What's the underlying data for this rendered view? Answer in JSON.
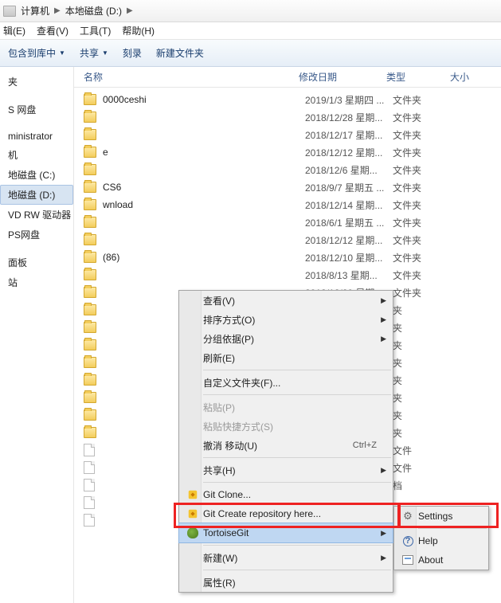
{
  "breadcrumb": {
    "seg1": "计算机",
    "seg2": "本地磁盘 (D:)"
  },
  "menubar": {
    "edit": "辑(E)",
    "view": "查看(V)",
    "tools": "工具(T)",
    "help": "帮助(H)"
  },
  "toolbar": {
    "include": "包含到库中",
    "share": "共享",
    "burn": "刻录",
    "newfolder": "新建文件夹"
  },
  "sidebar": {
    "items": [
      "夹",
      "",
      "S 网盘",
      "",
      "ministrator",
      "机",
      "地磁盘 (C:)",
      "地磁盘 (D:)",
      "VD RW 驱动器 (",
      "PS网盘",
      "",
      "面板",
      "站"
    ],
    "selected_index": 7
  },
  "columns": {
    "name": "名称",
    "date": "修改日期",
    "type": "类型",
    "size": "大小"
  },
  "files": [
    {
      "name": "0000ceshi",
      "date": "2019/1/3 星期四 ...",
      "type": "文件夹",
      "kind": "folder"
    },
    {
      "name": "",
      "date": "2018/12/28 星期...",
      "type": "文件夹",
      "kind": "folder"
    },
    {
      "name": "",
      "date": "2018/12/17 星期...",
      "type": "文件夹",
      "kind": "folder"
    },
    {
      "name": "e",
      "date": "2018/12/12 星期...",
      "type": "文件夹",
      "kind": "folder"
    },
    {
      "name": "",
      "date": "2018/12/6 星期...",
      "type": "文件夹",
      "kind": "folder"
    },
    {
      "name": "CS6",
      "date": "2018/9/7 星期五 ...",
      "type": "文件夹",
      "kind": "folder"
    },
    {
      "name": "wnload",
      "date": "2018/12/14 星期...",
      "type": "文件夹",
      "kind": "folder"
    },
    {
      "name": "",
      "date": "2018/6/1 星期五 ...",
      "type": "文件夹",
      "kind": "folder"
    },
    {
      "name": "",
      "date": "2018/12/12 星期...",
      "type": "文件夹",
      "kind": "folder"
    },
    {
      "name": "(86)",
      "date": "2018/12/10 星期...",
      "type": "文件夹",
      "kind": "folder"
    },
    {
      "name": "",
      "date": "2018/8/13 星期...",
      "type": "文件夹",
      "kind": "folder"
    },
    {
      "name": "",
      "date": "2018/12/20 星期...",
      "type": "文件夹",
      "kind": "folder"
    },
    {
      "name": "",
      "date": "",
      "type": "夹",
      "kind": "folder"
    },
    {
      "name": "",
      "date": "",
      "type": "夹",
      "kind": "folder"
    },
    {
      "name": "",
      "date": "",
      "type": "夹",
      "kind": "folder"
    },
    {
      "name": "",
      "date": "",
      "type": "夹",
      "kind": "folder"
    },
    {
      "name": "",
      "date": "",
      "type": "夹",
      "kind": "folder"
    },
    {
      "name": "",
      "date": "",
      "type": "夹",
      "kind": "folder"
    },
    {
      "name": "",
      "date": "",
      "type": "夹",
      "kind": "folder"
    },
    {
      "name": "",
      "date": "",
      "type": "夹",
      "kind": "folder"
    },
    {
      "name": "",
      "date": "",
      "type": "文件",
      "kind": "file"
    },
    {
      "name": "",
      "date": "",
      "type": "文件",
      "kind": "file"
    },
    {
      "name": "",
      "date": "",
      "type": "档",
      "kind": "file"
    },
    {
      "name": "",
      "date": "",
      "type": "",
      "kind": "file"
    },
    {
      "name": "",
      "date": "",
      "type": "",
      "kind": "file"
    }
  ],
  "ctx": {
    "view": "查看(V)",
    "sort": "排序方式(O)",
    "group": "分组依据(P)",
    "refresh": "刷新(E)",
    "customize": "自定义文件夹(F)...",
    "paste": "粘贴(P)",
    "paste_shortcut": "粘贴快捷方式(S)",
    "undo_move": "撤消 移动(U)",
    "undo_shortcut": "Ctrl+Z",
    "share": "共享(H)",
    "git_clone": "Git Clone...",
    "git_create": "Git Create repository here...",
    "tortoisegit": "TortoiseGit",
    "new": "新建(W)",
    "properties": "属性(R)"
  },
  "submenu": {
    "settings": "Settings",
    "help": "Help",
    "about": "About"
  }
}
